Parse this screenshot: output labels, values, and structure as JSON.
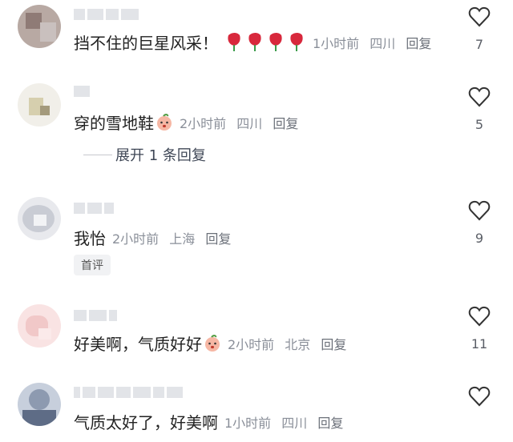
{
  "comments": [
    {
      "text": "挡不住的巨星风采！",
      "time": "1小时前",
      "location": "四川",
      "reply": "回复",
      "likes": "7",
      "emoji": "rose-bouquet"
    },
    {
      "text": "穿的雪地鞋",
      "time": "2小时前",
      "location": "四川",
      "reply": "回复",
      "likes": "5",
      "emoji": "peach-face"
    },
    {
      "text": "我怡",
      "time": "2小时前",
      "location": "上海",
      "reply": "回复",
      "likes": "9",
      "badge": "首评"
    },
    {
      "text": "好美啊，气质好好",
      "time": "2小时前",
      "location": "北京",
      "reply": "回复",
      "likes": "11",
      "emoji": "peach-face"
    },
    {
      "text": "气质太好了，好美啊",
      "time": "1小时前",
      "location": "四川",
      "reply": "回复",
      "likes": ""
    }
  ],
  "expand_replies": "展开 1 条回复",
  "icons": {
    "like": "heart-outline-icon",
    "rose": "rose-icon",
    "peach": "peach-face-icon"
  },
  "colors": {
    "meta": "#8a8f99",
    "text": "#222222",
    "rose": "#d8283c"
  }
}
